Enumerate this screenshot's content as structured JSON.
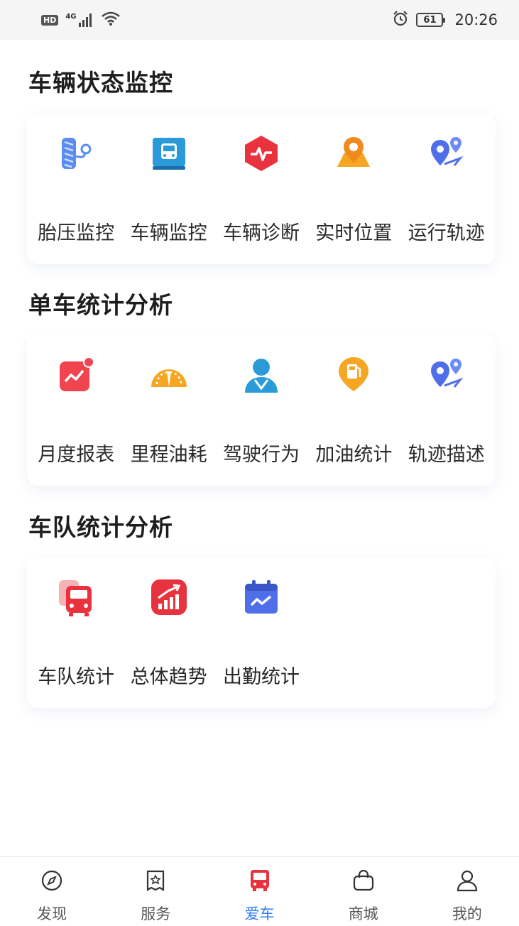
{
  "status_bar": {
    "hd": "HD",
    "network": "4G",
    "battery": "61",
    "time": "20:26"
  },
  "sections": [
    {
      "title": "车辆状态监控",
      "items": [
        {
          "label": "胎压监控",
          "icon": "tire-pressure-icon"
        },
        {
          "label": "车辆监控",
          "icon": "bus-monitor-icon"
        },
        {
          "label": "车辆诊断",
          "icon": "diagnosis-icon"
        },
        {
          "label": "实时位置",
          "icon": "location-map-icon"
        },
        {
          "label": "运行轨迹",
          "icon": "track-icon"
        }
      ]
    },
    {
      "title": "单车统计分析",
      "items": [
        {
          "label": "月度报表",
          "icon": "monthly-report-icon"
        },
        {
          "label": "里程油耗",
          "icon": "speedometer-icon"
        },
        {
          "label": "驾驶行为",
          "icon": "driver-icon"
        },
        {
          "label": "加油统计",
          "icon": "fuel-icon"
        },
        {
          "label": "轨迹描述",
          "icon": "track-icon"
        }
      ]
    },
    {
      "title": "车队统计分析",
      "items": [
        {
          "label": "车队统计",
          "icon": "fleet-icon"
        },
        {
          "label": "总体趋势",
          "icon": "trend-icon"
        },
        {
          "label": "出勤统计",
          "icon": "attendance-calendar-icon"
        }
      ]
    }
  ],
  "tabs": [
    {
      "label": "发现",
      "icon": "compass-icon",
      "active": false
    },
    {
      "label": "服务",
      "icon": "service-icon",
      "active": false
    },
    {
      "label": "爱车",
      "icon": "bus-icon",
      "active": true
    },
    {
      "label": "商城",
      "icon": "shopping-bag-icon",
      "active": false
    },
    {
      "label": "我的",
      "icon": "person-icon",
      "active": false
    }
  ],
  "colors": {
    "accent_blue": "#2f7df6",
    "accent_red": "#e8333f",
    "accent_orange": "#f5a623"
  }
}
